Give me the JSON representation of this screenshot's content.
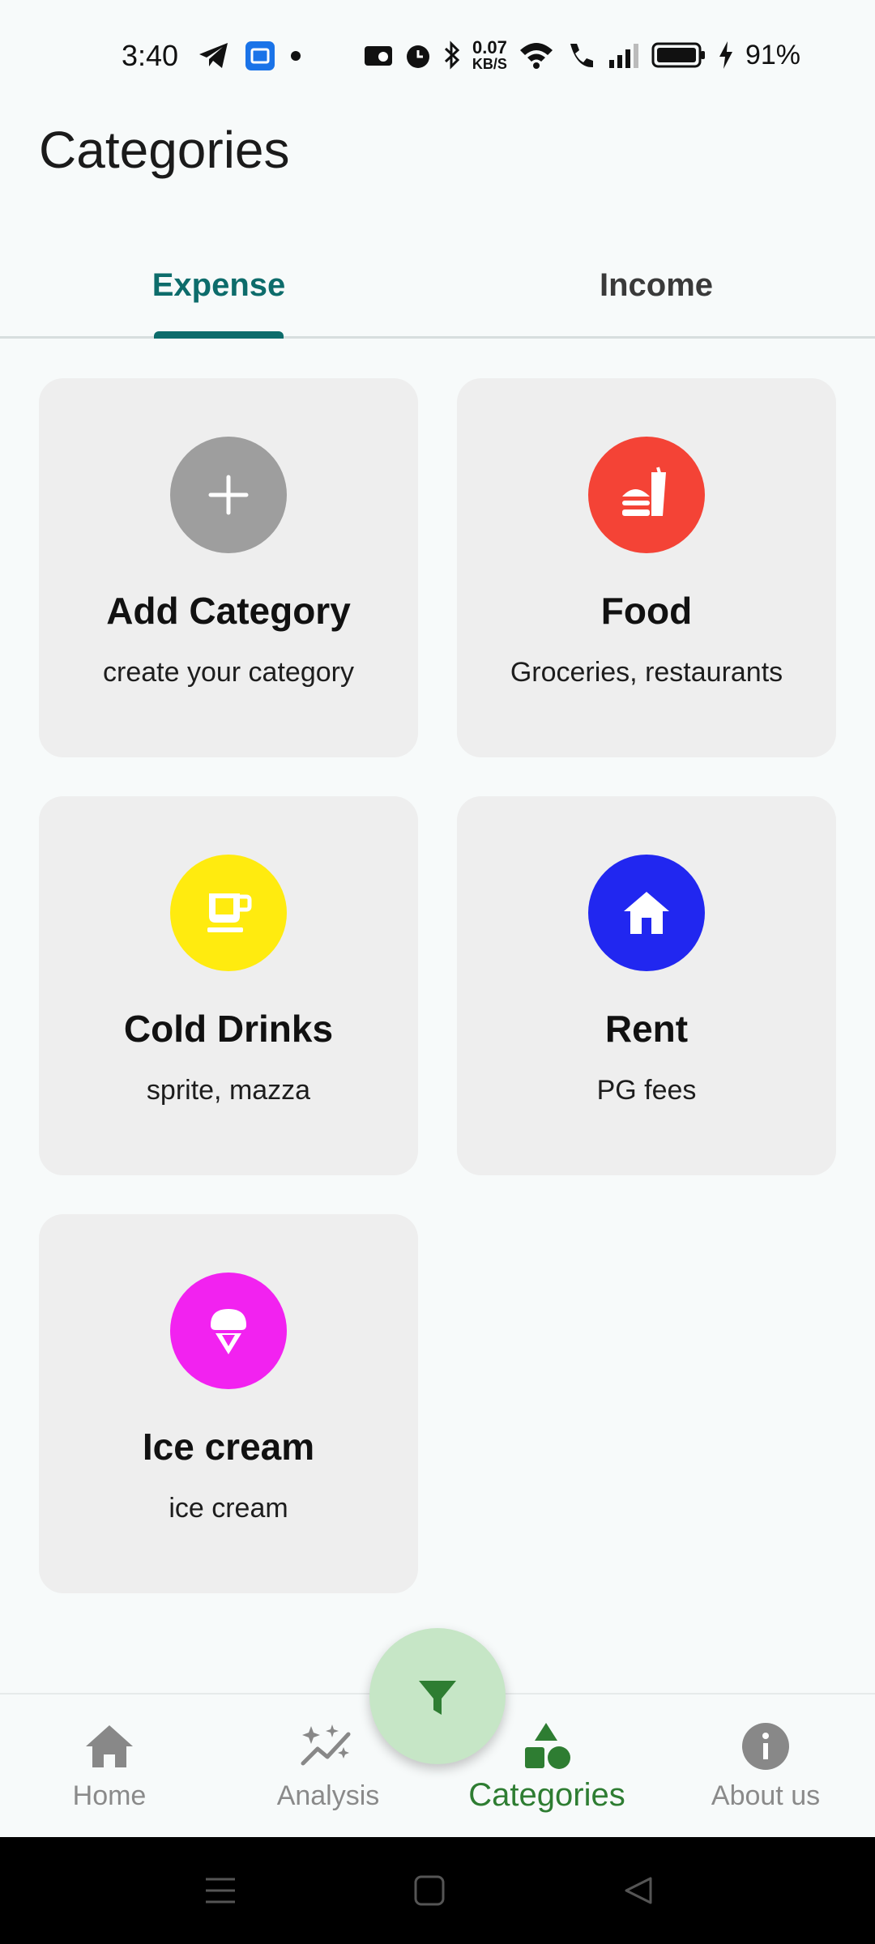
{
  "status_bar": {
    "time": "3:40",
    "net_speed_value": "0.07",
    "net_speed_unit": "KB/S",
    "battery_percent": "91%"
  },
  "page_title": "Categories",
  "tabs": [
    {
      "label": "Expense",
      "active": true
    },
    {
      "label": "Income",
      "active": false
    }
  ],
  "categories": [
    {
      "name": "Add Category",
      "description": "create your category",
      "icon": "plus-icon",
      "color": "#9e9e9e"
    },
    {
      "name": "Food",
      "description": "Groceries, restaurants",
      "icon": "fastfood-icon",
      "color": "#f44336"
    },
    {
      "name": "Cold Drinks",
      "description": "sprite, mazza",
      "icon": "cup-icon",
      "color": "#ffeb0f"
    },
    {
      "name": "Rent",
      "description": "PG fees",
      "icon": "house-icon",
      "color": "#2127f0"
    },
    {
      "name": "Ice cream",
      "description": "ice cream",
      "icon": "ice-cream-icon",
      "color": "#f222f0"
    }
  ],
  "fab": {
    "icon": "filter-icon",
    "color": "#c6e6c6"
  },
  "bottom_nav": [
    {
      "label": "Home",
      "icon": "home-icon",
      "active": false
    },
    {
      "label": "Analysis",
      "icon": "insights-icon",
      "active": false
    },
    {
      "label": "Categories",
      "icon": "category-shapes-icon",
      "active": true
    },
    {
      "label": "About us",
      "icon": "info-icon",
      "active": false
    }
  ],
  "colors": {
    "accent": "#0d6c6b",
    "nav_active": "#2e7d32",
    "card_bg": "#eeeeee"
  }
}
